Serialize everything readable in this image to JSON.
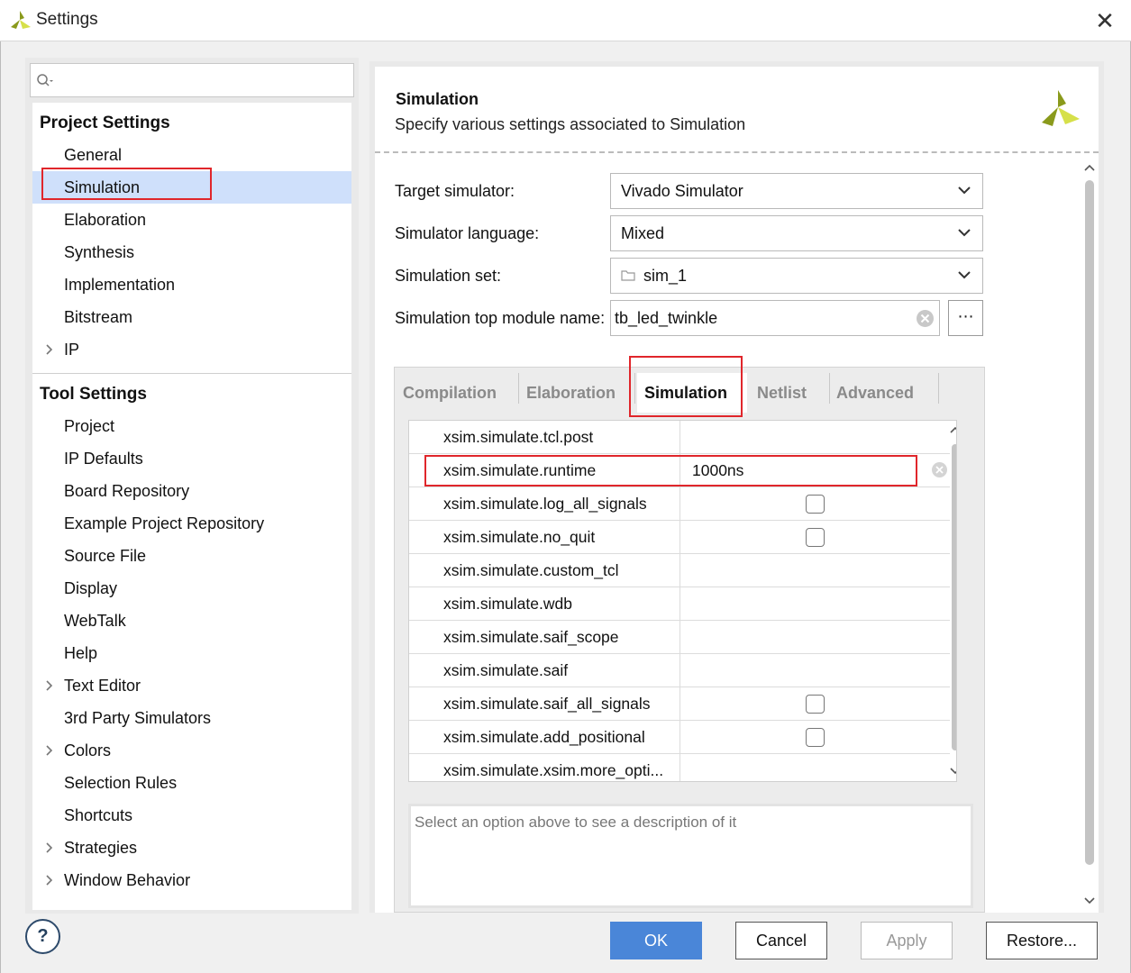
{
  "window": {
    "title": "Settings",
    "close_glyph": "✕"
  },
  "search": {
    "placeholder": "",
    "value": ""
  },
  "project_settings": {
    "header": "Project Settings",
    "items": [
      {
        "label": "General",
        "expandable": false
      },
      {
        "label": "Simulation",
        "expandable": false,
        "selected": true
      },
      {
        "label": "Elaboration",
        "expandable": false
      },
      {
        "label": "Synthesis",
        "expandable": false
      },
      {
        "label": "Implementation",
        "expandable": false
      },
      {
        "label": "Bitstream",
        "expandable": false
      },
      {
        "label": "IP",
        "expandable": true
      }
    ]
  },
  "tool_settings": {
    "header": "Tool Settings",
    "items": [
      {
        "label": "Project",
        "expandable": false
      },
      {
        "label": "IP Defaults",
        "expandable": false
      },
      {
        "label": "Board Repository",
        "expandable": false
      },
      {
        "label": "Example Project Repository",
        "expandable": false
      },
      {
        "label": "Source File",
        "expandable": false
      },
      {
        "label": "Display",
        "expandable": false
      },
      {
        "label": "WebTalk",
        "expandable": false
      },
      {
        "label": "Help",
        "expandable": false
      },
      {
        "label": "Text Editor",
        "expandable": true
      },
      {
        "label": "3rd Party Simulators",
        "expandable": false
      },
      {
        "label": "Colors",
        "expandable": true
      },
      {
        "label": "Selection Rules",
        "expandable": false
      },
      {
        "label": "Shortcuts",
        "expandable": false
      },
      {
        "label": "Strategies",
        "expandable": true
      },
      {
        "label": "Window Behavior",
        "expandable": true
      }
    ]
  },
  "page": {
    "title": "Simulation",
    "subtitle": "Specify various settings associated to Simulation"
  },
  "form": {
    "target_simulator": {
      "label": "Target simulator:",
      "value": "Vivado Simulator"
    },
    "simulator_language": {
      "label": "Simulator language:",
      "value": "Mixed"
    },
    "simulation_set": {
      "label": "Simulation set:",
      "value": "sim_1"
    },
    "top_module": {
      "label": "Simulation top module name:",
      "value": "tb_led_twinkle",
      "browse_label": "⋯"
    }
  },
  "tabs": [
    {
      "label": "Compilation",
      "active": false
    },
    {
      "label": "Elaboration",
      "active": false
    },
    {
      "label": "Simulation",
      "active": true
    },
    {
      "label": "Netlist",
      "active": false
    },
    {
      "label": "Advanced",
      "active": false
    }
  ],
  "properties": [
    {
      "name": "xsim.simulate.tcl.post",
      "value": "",
      "type": "text"
    },
    {
      "name": "xsim.simulate.runtime",
      "value": "1000ns",
      "type": "text"
    },
    {
      "name": "xsim.simulate.log_all_signals",
      "value": "",
      "type": "checkbox",
      "checked": false
    },
    {
      "name": "xsim.simulate.no_quit",
      "value": "",
      "type": "checkbox",
      "checked": false
    },
    {
      "name": "xsim.simulate.custom_tcl",
      "value": "",
      "type": "text"
    },
    {
      "name": "xsim.simulate.wdb",
      "value": "",
      "type": "text"
    },
    {
      "name": "xsim.simulate.saif_scope",
      "value": "",
      "type": "text"
    },
    {
      "name": "xsim.simulate.saif",
      "value": "",
      "type": "text"
    },
    {
      "name": "xsim.simulate.saif_all_signals",
      "value": "",
      "type": "checkbox",
      "checked": false
    },
    {
      "name": "xsim.simulate.add_positional",
      "value": "",
      "type": "checkbox",
      "checked": false
    },
    {
      "name": "xsim.simulate.xsim.more_opti...",
      "value": "",
      "type": "text"
    }
  ],
  "description": "Select an option above to see a description of it",
  "buttons": {
    "help": "?",
    "ok": "OK",
    "cancel": "Cancel",
    "apply": "Apply",
    "restore": "Restore..."
  },
  "colors": {
    "accent": "#4a86d8",
    "selection": "#cfe0fb",
    "highlight_box": "#e0262b",
    "logo_dark": "#8a9a1c",
    "logo_light": "#d6e04a"
  }
}
